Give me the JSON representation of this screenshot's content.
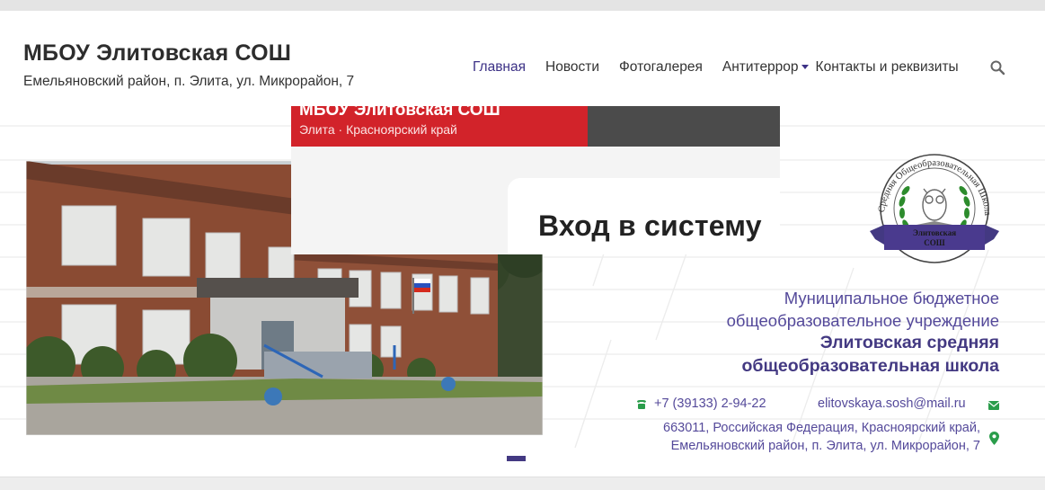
{
  "header": {
    "title": "МБОУ Элитовская СОШ",
    "address": "Емельяновский район, п. Элита, ул. Микрорайон, 7"
  },
  "nav": {
    "items": [
      {
        "label": "Главная",
        "active": true
      },
      {
        "label": "Новости"
      },
      {
        "label": "Фотогалерея"
      },
      {
        "label": "Антитеррор",
        "dropdown": true
      },
      {
        "label": "Контакты и реквизиты"
      }
    ],
    "search_icon": "search-icon"
  },
  "overlay": {
    "title": "МБОУ Элитовская СОШ",
    "subtitle": "Элита · Красноярский край",
    "login_heading": "Вход в систему"
  },
  "banner": {
    "line1": "Муниципальное бюджетное",
    "line2": "общеобразовательное учреждение",
    "line3": "Элитовская средняя",
    "line4": "общеобразовательная школа",
    "phone": "+7 (39133) 2-94-22",
    "email": "elitovskaya.sosh@mail.ru",
    "address1": "663011, Российская Федерация, Красноярский край,",
    "address2": "Емельяновский район, п. Элита, ул. Микрорайон, 7"
  },
  "logo": {
    "ring_text": "Средняя Общеобразовательная Школа",
    "ribbon_line1": "Элитовская",
    "ribbon_line2": "СОШ"
  },
  "slider": {
    "slide_count": 1,
    "active_slide": 1
  },
  "colors": {
    "brand_purple": "#433982",
    "nav_active": "#3c3186",
    "red": "#d2232a",
    "dark_gray": "#4b4b4b",
    "contact_green": "#2a9d4b"
  }
}
